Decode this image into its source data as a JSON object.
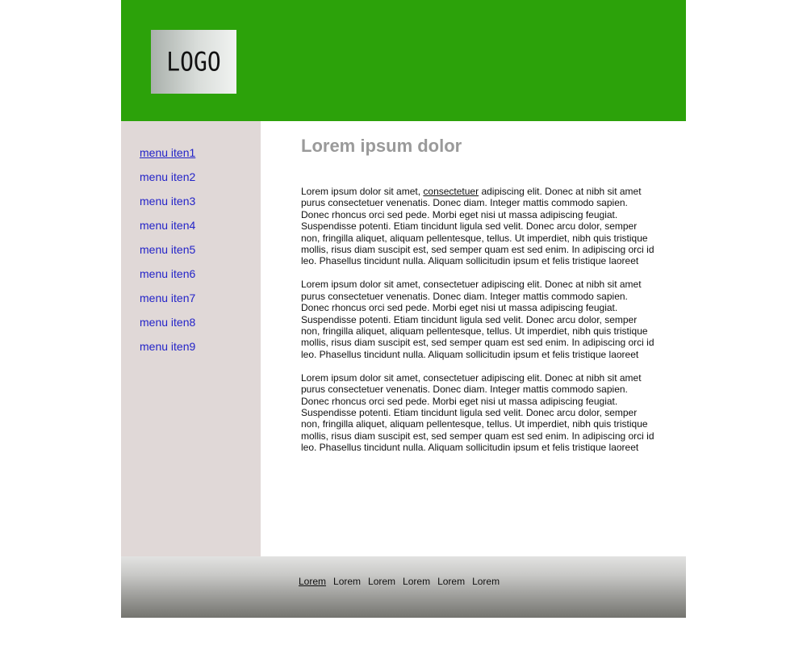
{
  "header": {
    "logo_text": "LOGO",
    "background_color": "#2ca20a"
  },
  "sidebar": {
    "items": [
      {
        "label": "menu iten1"
      },
      {
        "label": "menu iten2"
      },
      {
        "label": "menu iten3"
      },
      {
        "label": "menu iten4"
      },
      {
        "label": "menu iten5"
      },
      {
        "label": "menu iten6"
      },
      {
        "label": "menu iten7"
      },
      {
        "label": "menu iten8"
      },
      {
        "label": "menu iten9"
      }
    ]
  },
  "main": {
    "title": "Lorem ipsum dolor",
    "paragraph1": {
      "before": "Lorem ipsum dolor sit amet, ",
      "link": "consectetuer",
      "after": " adipiscing elit. Donec at nibh sit amet purus consectetuer venenatis. Donec diam. Integer mattis commodo sapien. Donec rhoncus orci sed pede. Morbi eget nisi ut massa adipiscing feugiat. Suspendisse potenti. Etiam tincidunt ligula sed velit. Donec arcu dolor, semper non, fringilla aliquet, aliquam pellentesque, tellus. Ut imperdiet, nibh quis tristique mollis, risus diam suscipit est, sed semper quam est sed enim. In adipiscing orci id leo. Phasellus tincidunt nulla. Aliquam sollicitudin ipsum et felis tristique laoreet"
    },
    "paragraph2": "Lorem ipsum dolor sit amet, consectetuer adipiscing elit. Donec at nibh sit amet purus consectetuer venenatis. Donec diam. Integer mattis commodo sapien. Donec rhoncus orci sed pede. Morbi eget nisi ut massa adipiscing feugiat. Suspendisse potenti. Etiam tincidunt ligula sed velit. Donec arcu dolor, semper non, fringilla aliquet, aliquam pellentesque, tellus. Ut imperdiet, nibh quis tristique mollis, risus diam suscipit est, sed semper quam est sed enim. In adipiscing orci id leo. Phasellus tincidunt nulla. Aliquam sollicitudin ipsum et felis tristique laoreet",
    "paragraph3": "Lorem ipsum dolor sit amet, consectetuer adipiscing elit. Donec at nibh sit amet purus consectetuer venenatis. Donec diam. Integer mattis commodo sapien. Donec rhoncus orci sed pede. Morbi eget nisi ut massa adipiscing feugiat. Suspendisse potenti. Etiam tincidunt ligula sed velit. Donec arcu dolor, semper non, fringilla aliquet, aliquam pellentesque, tellus. Ut imperdiet, nibh quis tristique mollis, risus diam suscipit est, sed semper quam est sed enim. In adipiscing orci id leo. Phasellus tincidunt nulla. Aliquam sollicitudin ipsum et felis tristique laoreet"
  },
  "footer": {
    "links": [
      {
        "label": "Lorem"
      },
      {
        "label": "Lorem"
      },
      {
        "label": "Lorem"
      },
      {
        "label": "Lorem"
      },
      {
        "label": "Lorem"
      },
      {
        "label": "Lorem"
      }
    ]
  }
}
